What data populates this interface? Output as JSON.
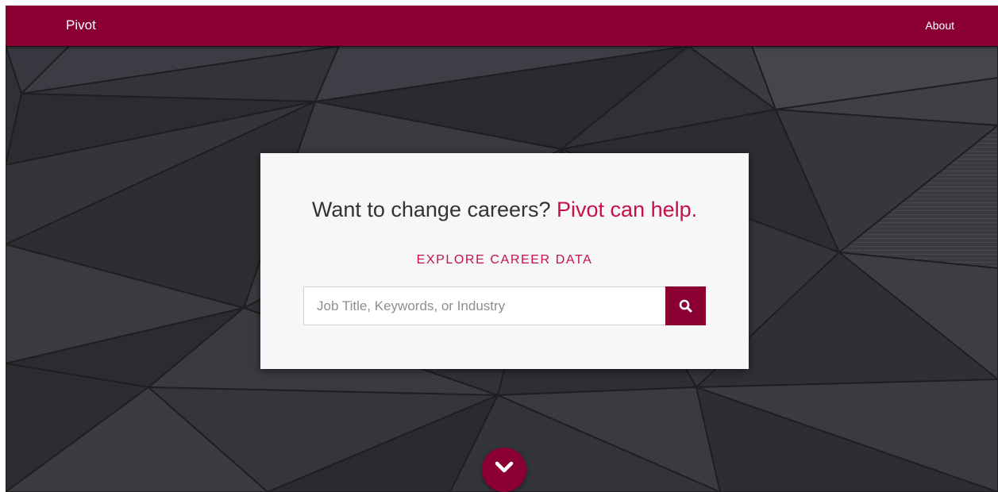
{
  "navbar": {
    "brand": "Pivot",
    "about_link": "About",
    "color": "#8a0033"
  },
  "hero": {
    "headline_main": "Want to change careers?",
    "headline_accent": "Pivot can help.",
    "accent_color": "#c70f46",
    "explore_link": "EXPLORE CAREER DATA",
    "search": {
      "placeholder": "Job Title, Keywords, or Industry",
      "value": "",
      "button_icon": "search-icon"
    },
    "scroll_icon": "chevron-down-icon"
  }
}
